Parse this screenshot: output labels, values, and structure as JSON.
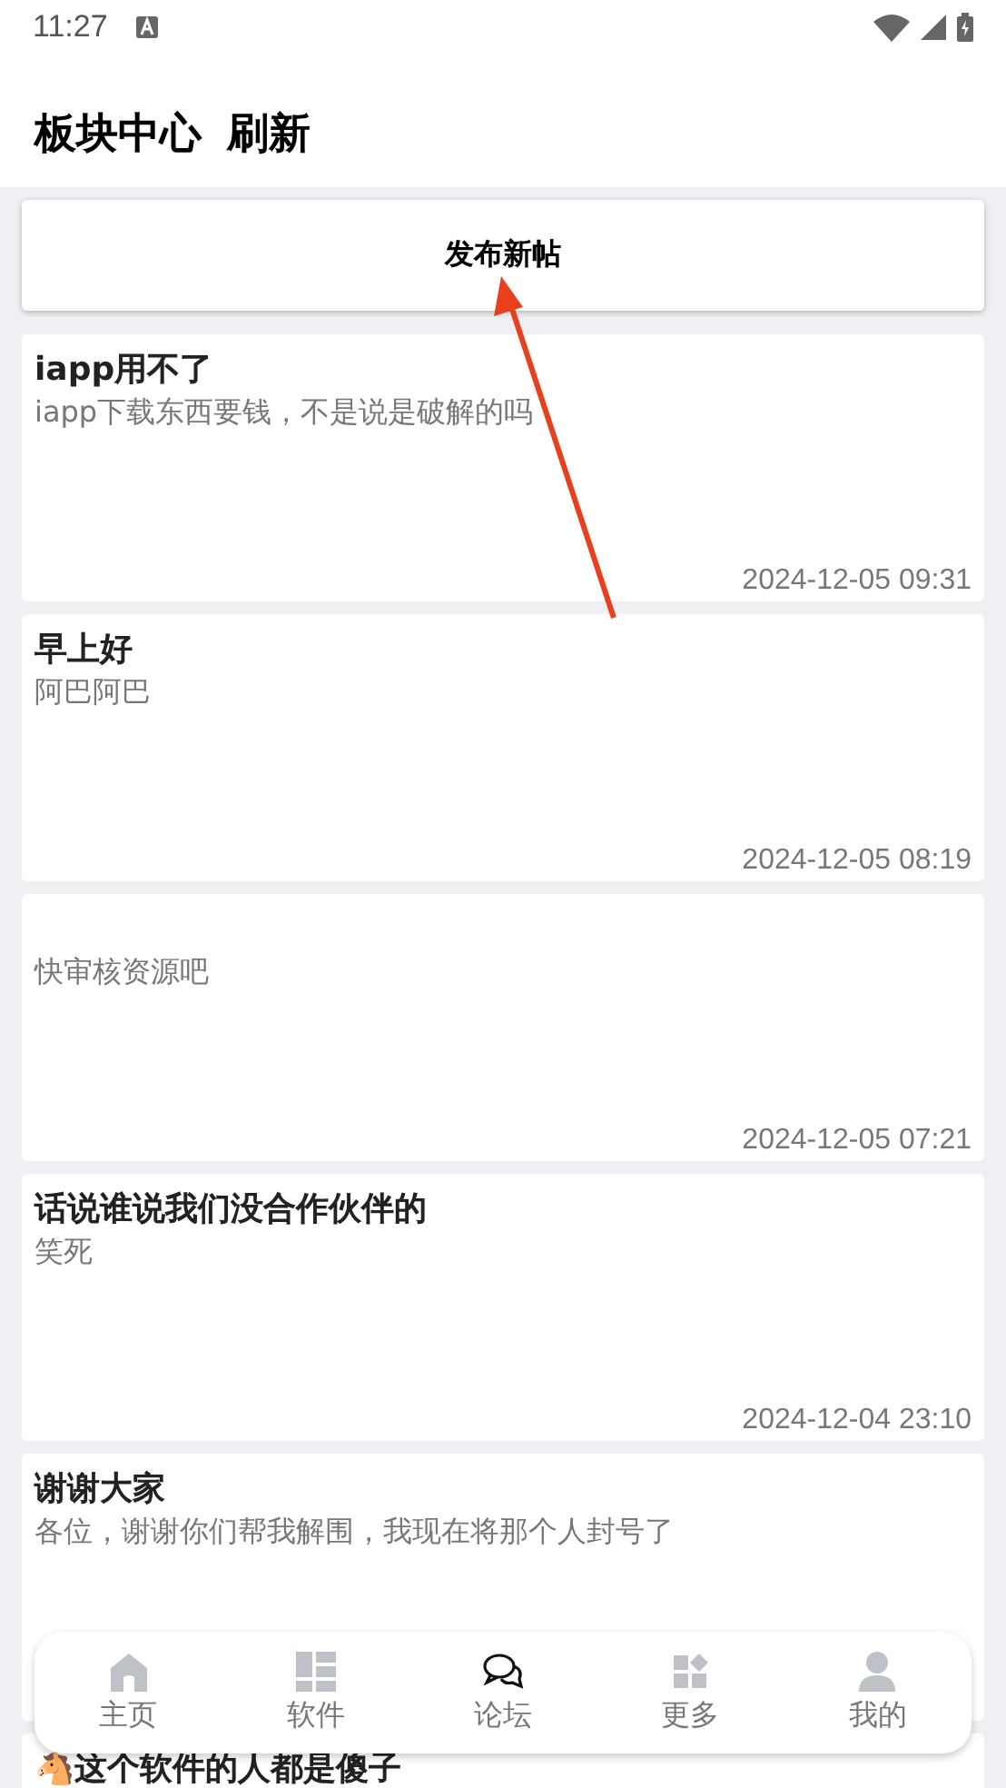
{
  "status_bar": {
    "time": "11:27"
  },
  "header": {
    "title": "板块中心",
    "action": "刷新"
  },
  "post_button": {
    "label": "发布新帖"
  },
  "posts": [
    {
      "title": "iapp用不了",
      "body": "iapp下载东西要钱，不是说是破解的吗",
      "date": "2024-12-05 09:31"
    },
    {
      "title": "早上好",
      "body": "阿巴阿巴",
      "date": "2024-12-05 08:19"
    },
    {
      "body": "快审核资源吧",
      "date": "2024-12-05 07:21"
    },
    {
      "title": "话说谁说我们没合作伙伴的",
      "body": "笑死",
      "date": "2024-12-04 23:10"
    },
    {
      "title": "谢谢大家",
      "body": "各位，谢谢你们帮我解围，我现在将那个人封号了"
    },
    {
      "title": "🐴这个软件的人都是傻子"
    }
  ],
  "bottom_nav": [
    {
      "kind": "home",
      "label": "主页",
      "selected": false
    },
    {
      "kind": "apps",
      "label": "软件",
      "selected": false
    },
    {
      "kind": "forum",
      "label": "论坛",
      "selected": true
    },
    {
      "kind": "more",
      "label": "更多",
      "selected": false
    },
    {
      "kind": "profile",
      "label": "我的",
      "selected": false
    }
  ]
}
